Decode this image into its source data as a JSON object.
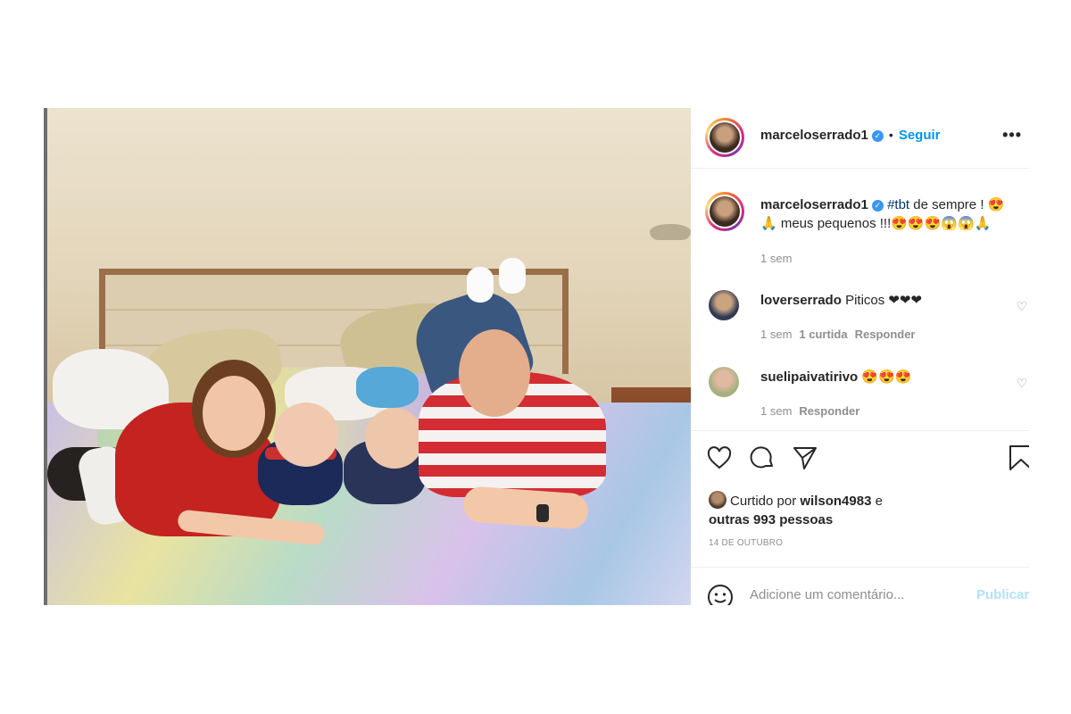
{
  "post": {
    "username": "marceloserrado1",
    "verified_icon": "verified-badge-icon",
    "separator": "•",
    "follow_label": "Seguir",
    "more_label": "•••",
    "caption": {
      "username": "marceloserrado1",
      "hashtag": "#tbt",
      "text_line1": " de sempre ! 😍",
      "text_line2": "🙏 meus pequenos !!!😍😍😍😱😱🙏",
      "time": "1 sem"
    },
    "comments": [
      {
        "username": "loverserrado",
        "text": "Piticos ❤❤❤",
        "time": "1 sem",
        "likes": "1 curtida",
        "reply": "Responder"
      },
      {
        "username": "suelipaivatirivo",
        "text": "😍😍😍",
        "time": "1 sem",
        "likes": "",
        "reply": "Responder"
      }
    ],
    "likes_prefix": "Curtido por ",
    "liked_by": "wilson4983",
    "likes_connector": " e",
    "likes_others": "outras 993 pessoas",
    "date": "14 DE OUTUBRO",
    "add_comment_placeholder": "Adicione um comentário...",
    "publish_label": "Publicar"
  },
  "icons": {
    "heart": "heart-icon",
    "comment": "comment-icon",
    "share": "share-icon",
    "save": "bookmark-icon",
    "emoji": "emoji-icon"
  },
  "colors": {
    "link": "#0095f6",
    "hashtag": "#00376b",
    "muted": "#8e8e8e",
    "publish_disabled": "#b2dffc"
  }
}
